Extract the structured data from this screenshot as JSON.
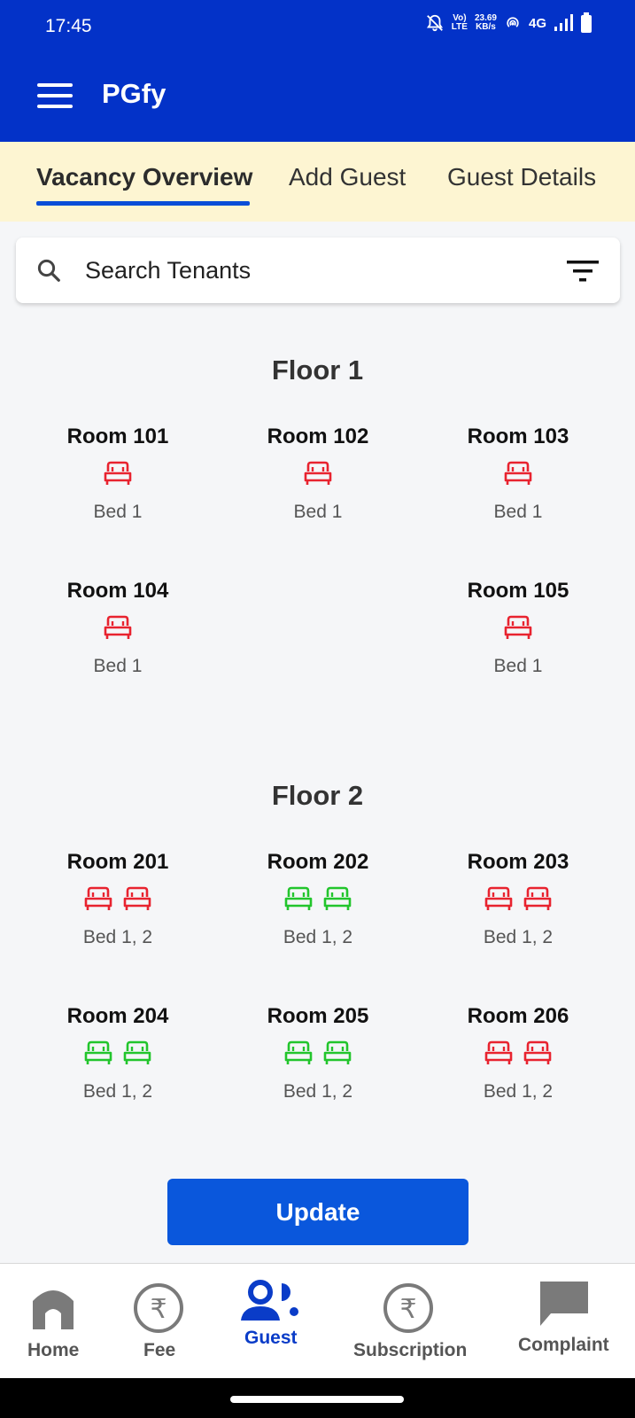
{
  "status_bar": {
    "time": "17:45",
    "volte_top": "Vo)",
    "volte_bottom": "LTE",
    "speed_top": "23.69",
    "speed_bottom": "KB/s",
    "network": "4G"
  },
  "app_bar": {
    "title": "PGfy"
  },
  "tabs": [
    {
      "label": "Vacancy Overview",
      "active": true
    },
    {
      "label": "Add Guest",
      "active": false
    },
    {
      "label": "Guest Details",
      "active": false
    }
  ],
  "search": {
    "placeholder": "Search Tenants",
    "value": ""
  },
  "colors": {
    "primary": "#0332c8",
    "occupied": "#e8232f",
    "vacant": "#22c52c",
    "tab_bg": "#fdf5d2"
  },
  "floors": [
    {
      "title": "Floor 1",
      "rooms": [
        {
          "name": "Room 101",
          "beds": [
            "occupied"
          ],
          "bed_label": "Bed 1"
        },
        {
          "name": "Room 102",
          "beds": [
            "occupied"
          ],
          "bed_label": "Bed 1"
        },
        {
          "name": "Room 103",
          "beds": [
            "occupied"
          ],
          "bed_label": "Bed 1"
        },
        {
          "name": "Room 104",
          "beds": [
            "occupied"
          ],
          "bed_label": "Bed 1"
        },
        {
          "name": "Room 105",
          "beds": [
            "occupied"
          ],
          "bed_label": "Bed 1"
        }
      ]
    },
    {
      "title": "Floor 2",
      "rooms": [
        {
          "name": "Room 201",
          "beds": [
            "occupied",
            "occupied"
          ],
          "bed_label": "Bed 1, 2"
        },
        {
          "name": "Room 202",
          "beds": [
            "vacant",
            "vacant"
          ],
          "bed_label": "Bed 1, 2"
        },
        {
          "name": "Room 203",
          "beds": [
            "occupied",
            "occupied"
          ],
          "bed_label": "Bed 1, 2"
        },
        {
          "name": "Room 204",
          "beds": [
            "vacant",
            "vacant"
          ],
          "bed_label": "Bed 1, 2"
        },
        {
          "name": "Room 205",
          "beds": [
            "vacant",
            "vacant"
          ],
          "bed_label": "Bed 1, 2"
        },
        {
          "name": "Room 206",
          "beds": [
            "occupied",
            "occupied"
          ],
          "bed_label": "Bed 1, 2"
        }
      ]
    }
  ],
  "update_label": "Update",
  "bottom_nav": [
    {
      "label": "Home",
      "icon": "home-icon",
      "active": false
    },
    {
      "label": "Fee",
      "icon": "rupee-icon",
      "active": false
    },
    {
      "label": "Guest",
      "icon": "guests-icon",
      "active": true
    },
    {
      "label": "Subscription",
      "icon": "rupee-icon",
      "active": false
    },
    {
      "label": "Complaint",
      "icon": "chat-bubble-icon",
      "active": false
    }
  ]
}
